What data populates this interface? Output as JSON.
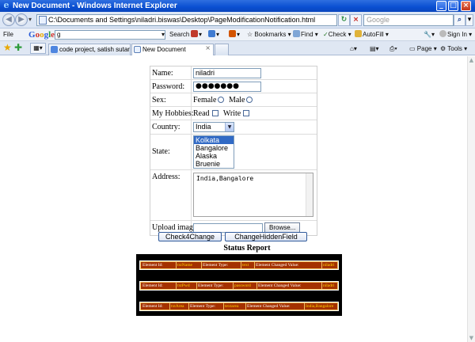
{
  "window": {
    "title": "New Document - Windows Internet Explorer",
    "url": "C:\\Documents and Settings\\niladri.biswas\\Desktop\\PageModificationNotification.html",
    "search_placeholder": "Google"
  },
  "toolbar": {
    "file_menu": "File",
    "google_input": "g",
    "search_label": "Search",
    "bookmarks_label": "Bookmarks",
    "find_label": "Find",
    "check_label": "Check",
    "autofill_label": "AutoFill",
    "signin_label": "Sign In"
  },
  "tabs": [
    {
      "label": "code project, satish sutar - G..."
    },
    {
      "label": "New Document"
    }
  ],
  "commandbar": {
    "page_label": "Page",
    "tools_label": "Tools"
  },
  "form": {
    "name_label": "Name:",
    "name_value": "niladri",
    "password_label": "Password:",
    "password_value": "●●●●●●●",
    "sex_label": "Sex:",
    "sex_options": [
      "Female",
      "Male"
    ],
    "hobbies_label": "My Hobbies:",
    "hobby_options": [
      "Read",
      "Write"
    ],
    "country_label": "Country:",
    "country_value": "India",
    "state_label": "State:",
    "state_options": [
      "Kolkata",
      "Bangalore",
      "Alaska",
      "Bruenie"
    ],
    "state_selected": "Kolkata",
    "address_label": "Address:",
    "address_value": "India,Bangalore",
    "upload_label": "Upload image",
    "browse_label": "Browse..."
  },
  "buttons": {
    "check": "Check4Change",
    "change_hidden": "ChangeHiddenField"
  },
  "report": {
    "title": "Status Report",
    "rows": [
      {
        "id_label": "Element Id:",
        "id_value": "txtName",
        "type_label": "Element Type:",
        "type_value": "text",
        "changed_label": "Element Changed Value:",
        "changed_value": "niladri"
      },
      {
        "id_label": "Element Id:",
        "id_value": "txtPwd",
        "type_label": "Element Type:",
        "type_value": "password",
        "changed_label": "Element Changed Value:",
        "changed_value": "niladri"
      },
      {
        "id_label": "Element Id:",
        "id_value": "txtArea",
        "type_label": "Element Type:",
        "type_value": "textarea",
        "changed_label": "Element Changed Value:",
        "changed_value": "India,Bangalore"
      }
    ]
  },
  "colors": {
    "titlebar": "#0a4fd1",
    "report_bg": "#000000",
    "report_row": "#a43100",
    "report_value": "#ffd400",
    "list_selected": "#316ac5"
  }
}
